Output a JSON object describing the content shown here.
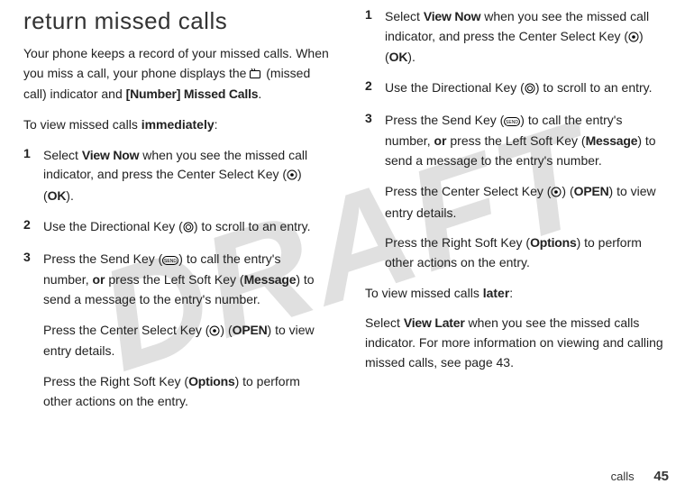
{
  "watermark": "DRAFT",
  "left": {
    "heading": "return missed calls",
    "intro_part1": "Your phone keeps a record of your missed calls. When you miss a call, your phone displays the ",
    "intro_part2": " (missed call) indicator and ",
    "intro_bold": "[Number] Missed Calls",
    "intro_part3": ".",
    "view_immediately_prefix": "To view missed calls ",
    "view_immediately_bold": "immediately",
    "view_immediately_suffix": ":",
    "steps": {
      "1": {
        "num": "1",
        "a": "Select ",
        "viewnow": "View Now",
        "b": " when you see the missed call indicator, and press the Center Select Key (",
        "c": ") (",
        "ok": "OK",
        "d": ")."
      },
      "2": {
        "num": "2",
        "a": "Use the Directional Key (",
        "b": ") to scroll to an entry."
      },
      "3": {
        "num": "3",
        "a": "Press the Send Key (",
        "b": ") to call the entry's number, ",
        "or": "or",
        "c": " press the Left Soft Key (",
        "message": "Message",
        "d": ") to send a message to the entry's number."
      }
    },
    "open_a": "Press the Center Select Key (",
    "open_b": ") (",
    "open_label": "OPEN",
    "open_c": ") to view entry details.",
    "options_a": "Press the Right Soft Key (",
    "options_label": "Options",
    "options_b": ") to perform other actions on the entry."
  },
  "right": {
    "steps": {
      "1": {
        "num": "1",
        "a": "Select ",
        "viewnow": "View Now",
        "b": " when you see the missed call indicator, and press the Center Select Key (",
        "c": ") (",
        "ok": "OK",
        "d": ")."
      },
      "2": {
        "num": "2",
        "a": "Use the Directional Key (",
        "b": ") to scroll to an entry."
      },
      "3": {
        "num": "3",
        "a": "Press the Send Key (",
        "b": ") to call the entry's number, ",
        "or": "or",
        "c": " press the Left Soft Key (",
        "message": "Message",
        "d": ") to send a message to the entry's number."
      }
    },
    "open_a": "Press the Center Select Key (",
    "open_b": ") (",
    "open_label": "OPEN",
    "open_c": ") to view entry details.",
    "options_a": "Press the Right Soft Key (",
    "options_label": "Options",
    "options_b": ") to perform other actions on the entry.",
    "later_prefix": "To view missed calls ",
    "later_bold": "later",
    "later_suffix": ":",
    "later_body_a": "Select ",
    "later_viewlater": "View Later",
    "later_body_b": " when you see the missed calls indicator. For more information on viewing and calling missed calls, see page 43."
  },
  "footer": {
    "section": "calls",
    "page": "45"
  }
}
